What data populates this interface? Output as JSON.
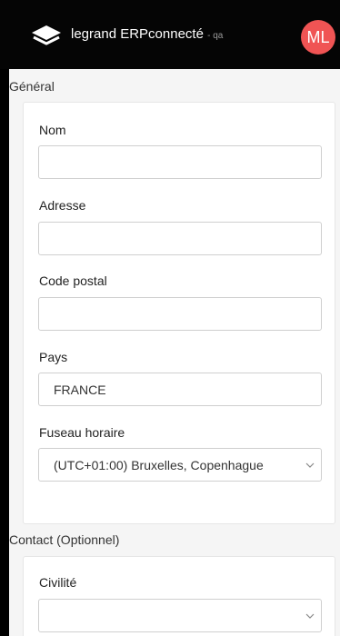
{
  "header": {
    "brand": "legrand ERPconnecté",
    "env": "- qa",
    "avatar_initials": "ML",
    "avatar_color": "#f05454"
  },
  "general": {
    "title": "Général",
    "fields": {
      "nom": {
        "label": "Nom",
        "value": ""
      },
      "adresse": {
        "label": "Adresse",
        "value": ""
      },
      "code_postal": {
        "label": "Code postal",
        "value": ""
      },
      "pays": {
        "label": "Pays",
        "value": "FRANCE"
      },
      "fuseau": {
        "label": "Fuseau horaire",
        "value": "(UTC+01:00) Bruxelles, Copenhague"
      }
    }
  },
  "contact": {
    "title": "Contact (Optionnel)",
    "fields": {
      "civilite": {
        "label": "Civilité",
        "value": ""
      }
    }
  }
}
